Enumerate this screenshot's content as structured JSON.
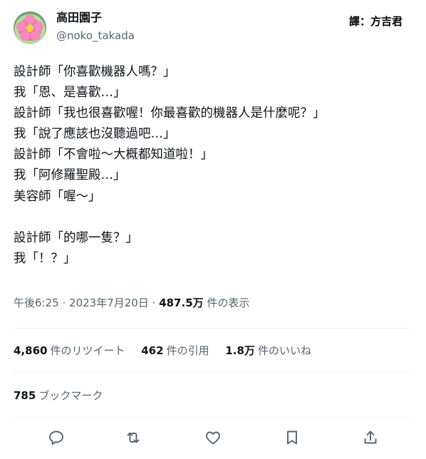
{
  "user": {
    "display_name": "高田園子",
    "handle": "@noko_takada",
    "avatar_icon": "flower-avatar-icon"
  },
  "translator_credit": "譯：方吉君",
  "tweet": {
    "lines": [
      "設計師「你喜歡機器人嗎？」",
      "我「恩、是喜歡…」",
      "設計師「我也很喜歡喔！你最喜歡的機器人是什麼呢？」",
      "我「說了應該也沒聽過吧…」",
      "設計師「不會啦～大概都知道啦！」",
      "我「阿修羅聖殿…」",
      "美容師「喔～」",
      "",
      "設計師「的哪一隻？」",
      "我「！？」"
    ]
  },
  "meta": {
    "time": "午後6:25",
    "separator": "·",
    "date": "2023年7月20日",
    "views_count": "487.5万",
    "views_label": "件の表示"
  },
  "stats": {
    "retweets_count": "4,860",
    "retweets_label": "件のリツイート",
    "quotes_count": "462",
    "quotes_label": "件の引用",
    "likes_count": "1.8万",
    "likes_label": "件のいいね",
    "bookmarks_count": "785",
    "bookmarks_label": "ブックマーク"
  },
  "actions": {
    "reply_icon": "reply-icon",
    "retweet_icon": "retweet-icon",
    "like_icon": "heart-icon",
    "bookmark_icon": "bookmark-icon",
    "share_icon": "share-icon"
  },
  "colors": {
    "text_primary": "#0f1419",
    "text_secondary": "#536471",
    "divider": "#eff3f4",
    "icon": "#536471"
  }
}
